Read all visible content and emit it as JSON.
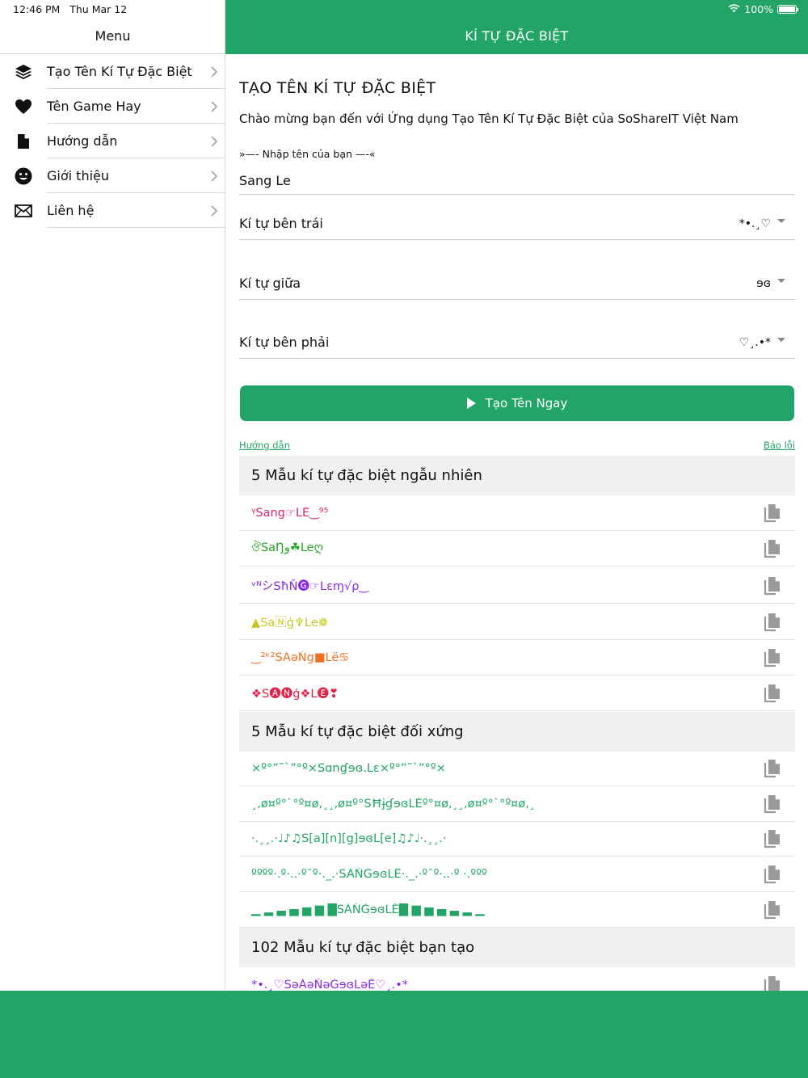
{
  "status": {
    "time": "12:46 PM",
    "date": "Thu Mar 12",
    "battery": "100%",
    "battery_level": 1.0
  },
  "sidebar": {
    "title": "Menu",
    "items": [
      {
        "label": "Tạo Tên Kí Tự Đặc Biệt",
        "icon": "layers-icon"
      },
      {
        "label": "Tên Game Hay",
        "icon": "heart-icon"
      },
      {
        "label": "Hướng dẫn",
        "icon": "document-icon"
      },
      {
        "label": "Giới thiệu",
        "icon": "smiley-icon"
      },
      {
        "label": "Liên hệ",
        "icon": "mail-icon"
      }
    ]
  },
  "header": {
    "title": "KÍ TỰ ĐẶC BIỆT"
  },
  "main": {
    "title": "TẠO TÊN KÍ TỰ ĐẶC BIỆT",
    "welcome": "Chào mừng bạn đến với Ứng dụng Tạo Tên Kí Tự Đặc Biệt của SoShareIT Việt Nam",
    "input_label": "»—- Nhập tên của bạn —-«",
    "input_value": "Sang Le",
    "selects": [
      {
        "label": "Kí tự bên trái",
        "value": "*•.¸♡"
      },
      {
        "label": "Kí tự giữa",
        "value": "ɘɞ"
      },
      {
        "label": "Kí tự bên phải",
        "value": "♡¸.•*"
      }
    ],
    "create_button": "Tạo Tên Ngay",
    "guide_link": "Hướng dẫn",
    "report_link": "Báo lỗi",
    "sections": [
      {
        "title": "5 Mẫu kí tự đặc biệt ngẫu nhiên",
        "rows": [
          {
            "text": "ᵞSang☞LĔ‿⁹⁵",
            "color": "#d6247a"
          },
          {
            "text": "ঔSaŊو☘Leღ",
            "color": "#27a327"
          },
          {
            "text": "ᵛᴺシSħŇ🅖☞Lɛɱ√ρ‿",
            "color": "#8a2be2"
          },
          {
            "text": "▲Sa🄽ģ♆Le❁",
            "color": "#c8c81e"
          },
          {
            "text": "‿²ᵏ²SÁǝŇg■Lë♋",
            "color": "#f07020"
          },
          {
            "text": "❖S🅐🅝ģ❖L🅔❣",
            "color": "#e0244a"
          }
        ]
      },
      {
        "title": "5 Mẫu kí tự đặc biệt đối xứng",
        "rows": [
          {
            "text": "×º°”˜`”°º×Sɑnɠɘɞ.Lɛ×º°”˜`”°º×",
            "color": "#22a466"
          },
          {
            "text": "¸,ø¤º°`°º¤ø,¸¸,ø¤º°SĦɉɠɘɞLĔº°¤ø,¸¸,ø¤º°`°º¤ø,¸",
            "color": "#22a466"
          },
          {
            "text": "·.¸¸.·♩♪♫S[a][n][g]ɘɞL[e]♫♪♩·.¸¸.·",
            "color": "#22a466"
          },
          {
            "text": "ºººº·.º·..·º¯º·._.·SÄŇĜɘɞLË·._.·º¯º·..·º ·.ººº",
            "color": "#22a466"
          },
          {
            "text": "▁ ▂ ▃ ▄ ▅ ▆ █SĂŇĞɘɞLĚ█ ▆ ▅ ▄ ▃ ▂ ▁",
            "color": "#22a466"
          }
        ]
      },
      {
        "title": "102 Mẫu kí tự đặc biệt bạn tạo",
        "rows": [
          {
            "text": "*•.¸♡SǝĂǝŇǝĞɘɞLǝĚ♡¸.•*",
            "color": "#8a2be2"
          }
        ]
      }
    ]
  },
  "colors": {
    "accent": "#22a466",
    "section_bg": "#f0f0f0",
    "divider": "#d8d8d8",
    "icon": "#9a9a9a"
  }
}
